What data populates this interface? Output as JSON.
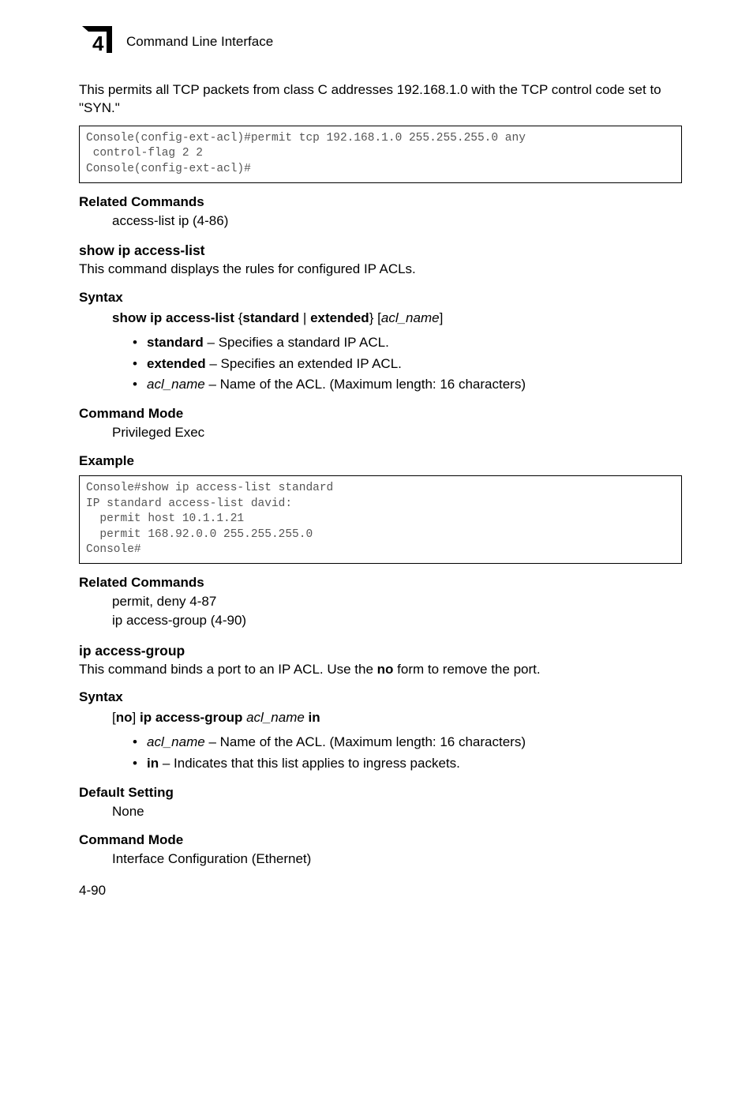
{
  "header": {
    "chapter_num": "4",
    "title": "Command Line Interface"
  },
  "intro_para": "This permits all TCP packets from class C addresses 192.168.1.0 with the TCP control code set to \"SYN.\"",
  "code1": "Console(config-ext-acl)#permit tcp 192.168.1.0 255.255.255.0 any \n control-flag 2 2\nConsole(config-ext-acl)#",
  "related1_head": "Related Commands",
  "related1_item": "access-list ip (4-86)",
  "sec_show": {
    "title": "show ip access-list",
    "desc": "This command displays the rules for configured IP ACLs.",
    "syntax_head": "Syntax",
    "syntax_lead": "show ip access-list",
    "syntax_brace_open": "{",
    "syntax_opt1": "standard",
    "syntax_sep": "|",
    "syntax_opt2": "extended",
    "syntax_brace_close": "}",
    "syntax_bracket_open": "[",
    "syntax_arg": "acl_name",
    "syntax_bracket_close": "]",
    "bullets": {
      "b1_bold": "standard",
      "b1_rest": " – Specifies a standard IP ACL.",
      "b2_bold": "extended",
      "b2_rest": " – Specifies an extended IP ACL.",
      "b3_ital": "acl_name",
      "b3_rest": " – Name of the ACL. (Maximum length: 16 characters)"
    },
    "cmdmode_head": "Command Mode",
    "cmdmode_val": "Privileged Exec",
    "example_head": "Example"
  },
  "code2": "Console#show ip access-list standard\nIP standard access-list david:\n  permit host 10.1.1.21\n  permit 168.92.0.0 255.255.255.0\nConsole#",
  "related2_head": "Related Commands",
  "related2_items": "permit, deny 4-87\nip access-group (4-90)",
  "sec_ip": {
    "title": "ip access-group",
    "desc_pre": "This command binds a port to an IP ACL. Use the ",
    "desc_bold": "no",
    "desc_post": " form to remove the port.",
    "syntax_head": "Syntax",
    "syntax_bracket_open": "[",
    "syntax_no": "no",
    "syntax_bracket_close": "]",
    "syntax_cmd": "ip access-group",
    "syntax_arg": "acl_name",
    "syntax_in": "in",
    "bullets": {
      "b1_ital": "acl_name",
      "b1_rest": " – Name of the ACL. (Maximum length: 16 characters)",
      "b2_bold": "in",
      "b2_rest": " – Indicates that this list applies to ingress packets."
    },
    "default_head": "Default Setting",
    "default_val": "None",
    "cmdmode_head": "Command Mode",
    "cmdmode_val": "Interface Configuration (Ethernet)"
  },
  "page_num": "4-90"
}
